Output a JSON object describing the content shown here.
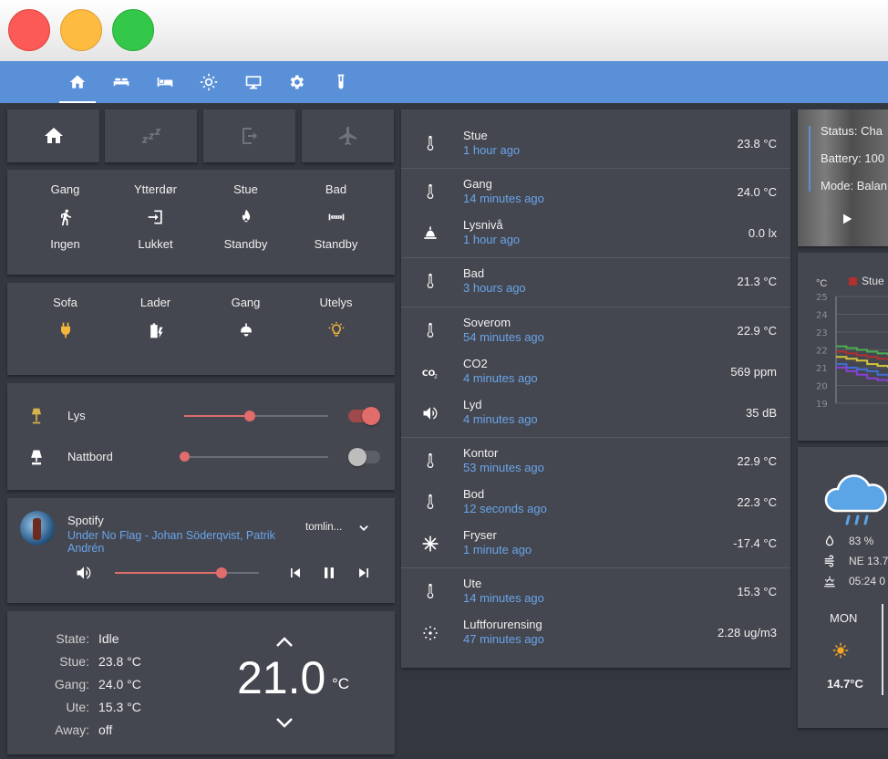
{
  "nav": {
    "tabs": [
      {
        "name": "home"
      },
      {
        "name": "bedroom"
      },
      {
        "name": "guestroom"
      },
      {
        "name": "lights"
      },
      {
        "name": "media"
      },
      {
        "name": "settings"
      },
      {
        "name": "lab"
      }
    ]
  },
  "modes": [
    {
      "name": "home-mode",
      "icon": "home-icon"
    },
    {
      "name": "sleep-mode",
      "icon": "zzz-icon"
    },
    {
      "name": "away-mode",
      "icon": "exit-icon"
    },
    {
      "name": "vacation-mode",
      "icon": "airplane-icon"
    }
  ],
  "sensors_grid": [
    {
      "name": "Gang",
      "state": "Ingen",
      "icon": "walk-icon"
    },
    {
      "name": "Ytterdør",
      "state": "Lukket",
      "icon": "door-enter-icon"
    },
    {
      "name": "Stue",
      "state": "Standby",
      "icon": "fire-icon"
    },
    {
      "name": "Bad",
      "state": "Standby",
      "icon": "heater-icon"
    }
  ],
  "switches_grid": [
    {
      "name": "Sofa",
      "icon": "plug-icon",
      "color": "#f4b73e"
    },
    {
      "name": "Lader",
      "icon": "battery-charging-icon",
      "color": "#ffffff"
    },
    {
      "name": "Gang",
      "icon": "ceiling-light-icon",
      "color": "#ffffff"
    },
    {
      "name": "Utelys",
      "icon": "bulb-icon",
      "color": "#f4b73e"
    }
  ],
  "lights": [
    {
      "name": "Lys",
      "level": 0.46,
      "on": true,
      "icon": "floor-lamp-icon",
      "icon_color": "#d8b24a"
    },
    {
      "name": "Nattbord",
      "level": 0.0,
      "on": false,
      "icon": "table-lamp-icon",
      "icon_color": "#ffffff"
    }
  ],
  "spotify": {
    "title": "Spotify",
    "track": "Under No Flag - Johan Söderqvist, Patrik Andrén",
    "source": "tomlin...",
    "volume": 0.74
  },
  "thermostat": {
    "rows": [
      {
        "label": "State:",
        "value": "Idle"
      },
      {
        "label": "Stue:",
        "value": "23.8 °C"
      },
      {
        "label": "Gang:",
        "value": "24.0 °C"
      },
      {
        "label": "Ute:",
        "value": "15.3 °C"
      },
      {
        "label": "Away:",
        "value": "off"
      }
    ],
    "target": "21.0",
    "unit": "°C"
  },
  "sensor_list": [
    {
      "name": "Stue",
      "time": "1 hour ago",
      "value": "23.8 °C",
      "icon": "thermometer-icon"
    },
    {
      "name": "Gang",
      "time": "14 minutes ago",
      "value": "24.0 °C",
      "icon": "thermometer-icon"
    },
    {
      "name": "Lysnivå",
      "time": "1 hour ago",
      "value": "0.0 lx",
      "icon": "light-level-icon"
    },
    {
      "name": "Bad",
      "time": "3 hours ago",
      "value": "21.3 °C",
      "icon": "thermometer-icon"
    },
    {
      "name": "Soverom",
      "time": "54 minutes ago",
      "value": "22.9 °C",
      "icon": "thermometer-icon"
    },
    {
      "name": "CO2",
      "time": "4 minutes ago",
      "value": "569 ppm",
      "icon": "co2-icon"
    },
    {
      "name": "Lyd",
      "time": "4 minutes ago",
      "value": "35 dB",
      "icon": "speaker-icon"
    },
    {
      "name": "Kontor",
      "time": "53 minutes ago",
      "value": "22.9 °C",
      "icon": "thermometer-icon"
    },
    {
      "name": "Bod",
      "time": "12 seconds ago",
      "value": "22.3 °C",
      "icon": "thermometer-icon"
    },
    {
      "name": "Fryser",
      "time": "1 minute ago",
      "value": "-17.4 °C",
      "icon": "snowflake-icon"
    },
    {
      "name": "Ute",
      "time": "14 minutes ago",
      "value": "15.3 °C",
      "icon": "thermometer-icon"
    },
    {
      "name": "Luftforurensing",
      "time": "47 minutes ago",
      "value": "2.28 ug/m3",
      "icon": "air-quality-icon"
    }
  ],
  "vacuum": {
    "status": "Status: Cha",
    "battery": "Battery: 100",
    "mode": "Mode: Balan"
  },
  "chart_data": {
    "type": "line",
    "ylabel": "°C",
    "legend": [
      {
        "name": "Stue",
        "color": "#b03030"
      }
    ],
    "ticks": [
      "25",
      "24",
      "23",
      "22",
      "21",
      "20",
      "19"
    ],
    "ylim": [
      19,
      25
    ],
    "series": [
      {
        "name": "Stue",
        "color": "#b03030",
        "values": [
          21.9,
          21.8,
          21.7,
          21.6,
          21.5,
          21.5
        ]
      },
      {
        "name": "",
        "color": "#4caf50",
        "values": [
          22.2,
          22.1,
          22.0,
          21.9,
          21.8,
          21.7
        ]
      },
      {
        "name": "",
        "color": "#d4c43a",
        "values": [
          21.6,
          21.5,
          21.4,
          21.2,
          21.1,
          21.0
        ]
      },
      {
        "name": "",
        "color": "#3f6fd6",
        "values": [
          21.2,
          21.0,
          20.9,
          20.8,
          20.6,
          20.5
        ]
      },
      {
        "name": "",
        "color": "#8a3fd6",
        "values": [
          21.0,
          20.8,
          20.6,
          20.4,
          20.3,
          20.2
        ]
      }
    ]
  },
  "weather": {
    "humidity": "83 %",
    "wind": "NE 13.7",
    "sunrise": "05:24 0",
    "day": "MON",
    "temp": "14.7°C"
  }
}
